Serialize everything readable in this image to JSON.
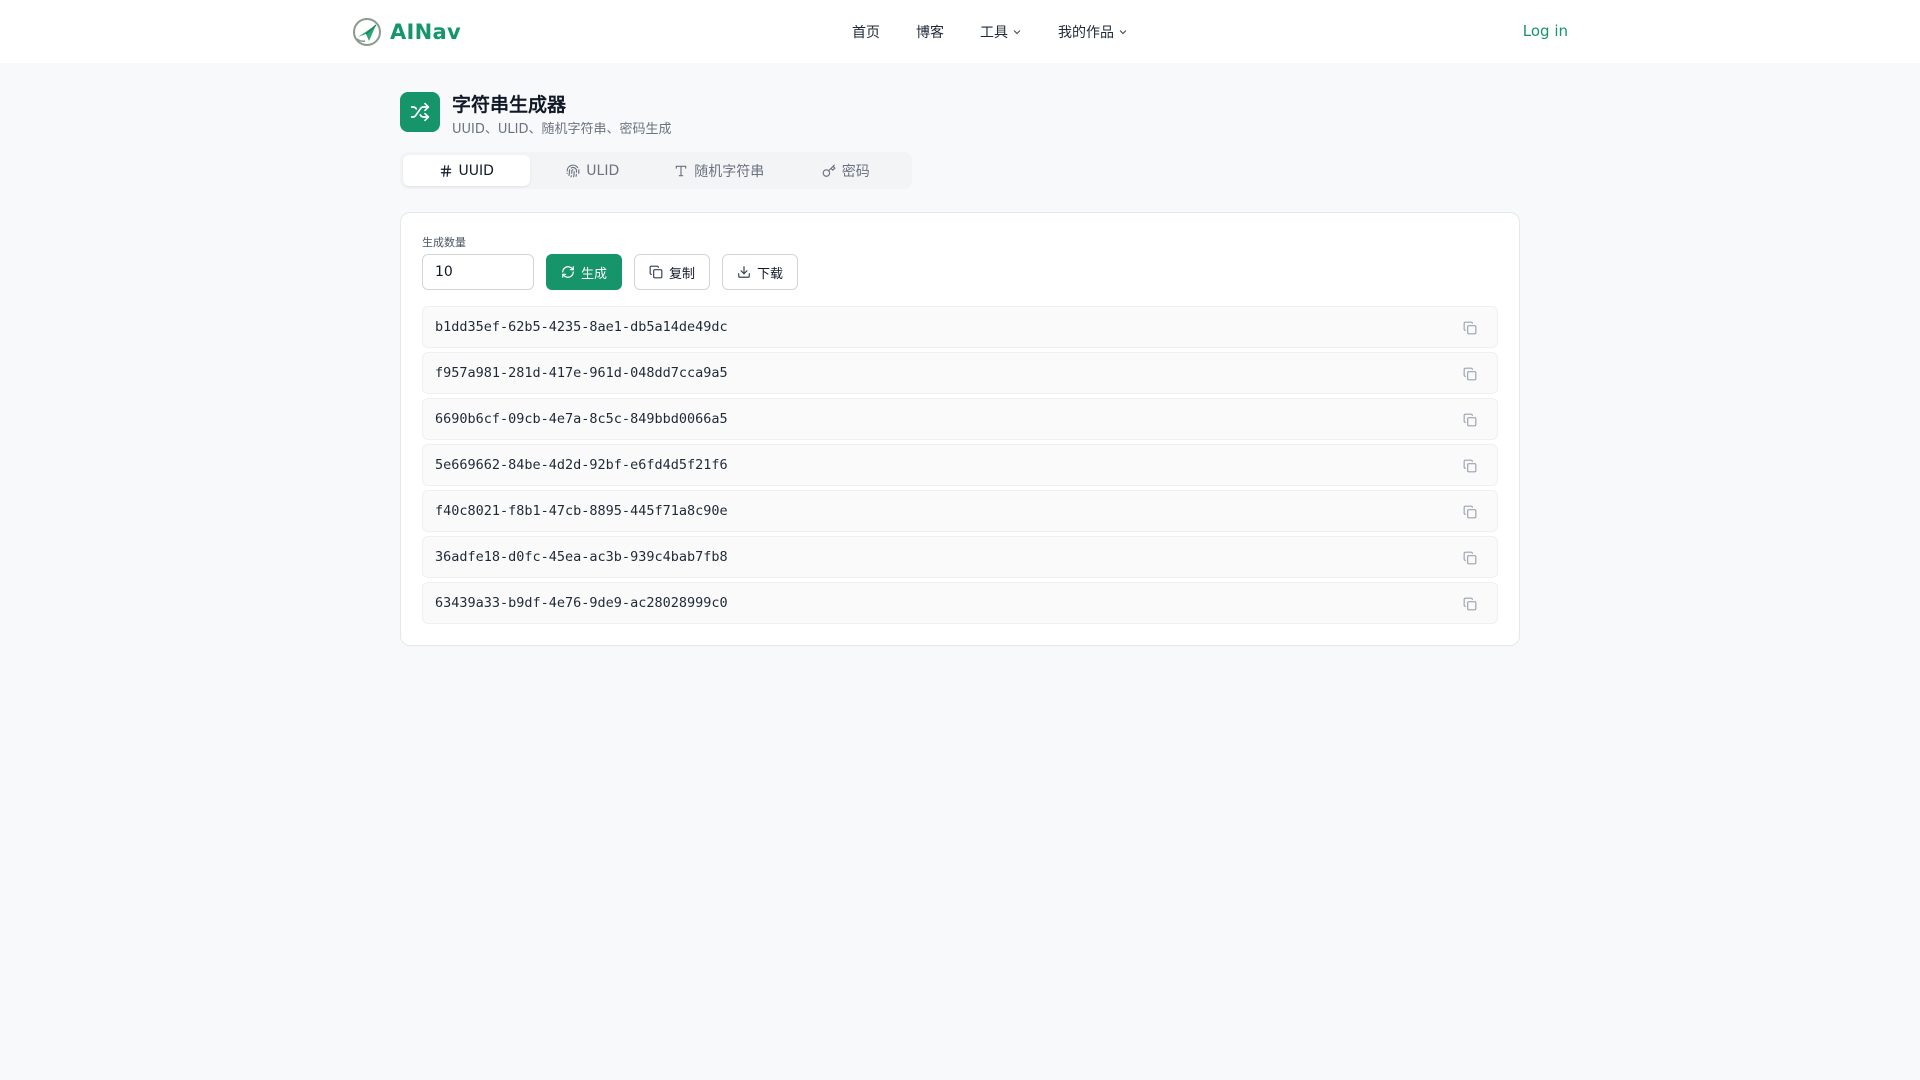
{
  "brand": {
    "name": "AINav",
    "color": "#16956a"
  },
  "nav": {
    "items": [
      {
        "label": "首页",
        "dropdown": false
      },
      {
        "label": "博客",
        "dropdown": false
      },
      {
        "label": "工具",
        "dropdown": true
      },
      {
        "label": "我的作品",
        "dropdown": true
      }
    ],
    "login_label": "Log in"
  },
  "page": {
    "icon": "shuffle-icon",
    "title": "字符串生成器",
    "subtitle": "UUID、ULID、随机字符串、密码生成"
  },
  "tabs": [
    {
      "label": "UUID",
      "icon": "hash-icon",
      "active": true
    },
    {
      "label": "ULID",
      "icon": "fingerprint-icon",
      "active": false
    },
    {
      "label": "随机字符串",
      "icon": "type-icon",
      "active": false
    },
    {
      "label": "密码",
      "icon": "key-icon",
      "active": false
    }
  ],
  "generator": {
    "count_label": "生成数量",
    "count_value": "10",
    "generate_label": "生成",
    "copy_label": "复制",
    "download_label": "下载"
  },
  "results": [
    "b1dd35ef-62b5-4235-8ae1-db5a14de49dc",
    "f957a981-281d-417e-961d-048dd7cca9a5",
    "6690b6cf-09cb-4e7a-8c5c-849bbd0066a5",
    "5e669662-84be-4d2d-92bf-e6fd4d5f21f6",
    "f40c8021-f8b1-47cb-8895-445f71a8c90e",
    "36adfe18-d0fc-45ea-ac3b-939c4bab7fb8",
    "63439a33-b9df-4e76-9de9-ac28028999c0"
  ]
}
